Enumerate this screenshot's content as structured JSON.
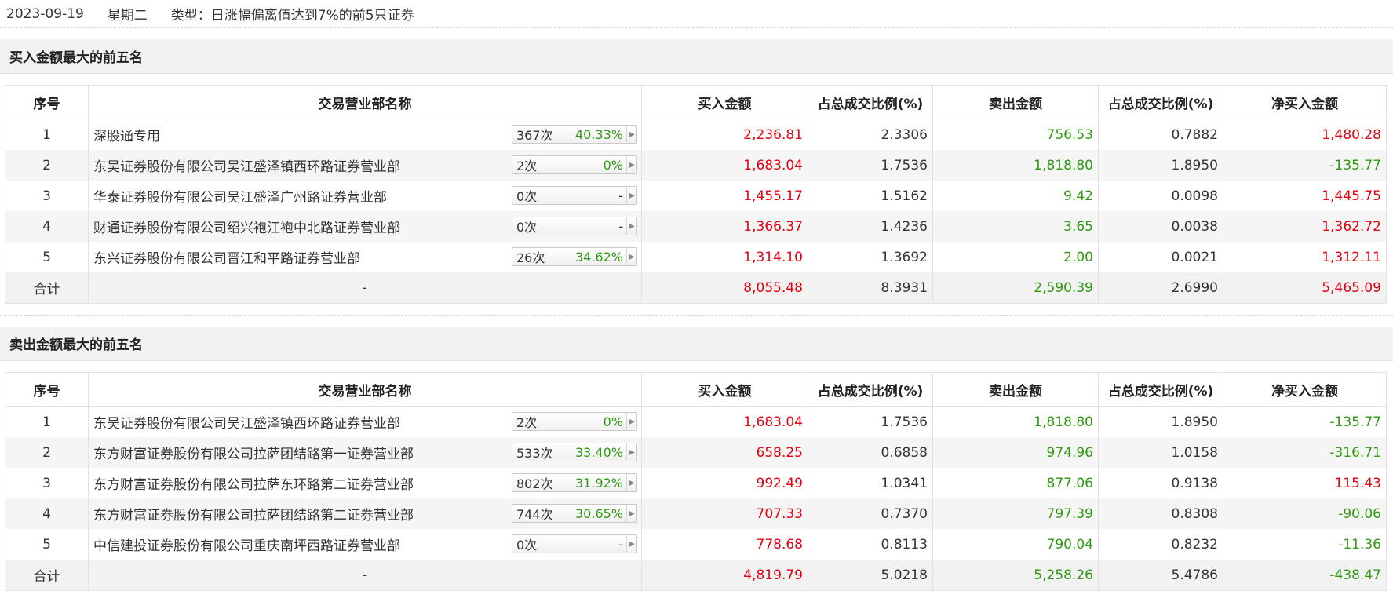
{
  "header": {
    "date": "2023-09-19",
    "weekday": "星期二",
    "type_label": "类型：日涨幅偏离值达到7%的前5只证券"
  },
  "columns": [
    "序号",
    "交易营业部名称",
    "买入金额",
    "占总成交比例(%)",
    "卖出金额",
    "占总成交比例(%)",
    "净买入金额"
  ],
  "colors": {
    "positive": "#e4000f",
    "negative": "#2f9a10"
  },
  "buy_section": {
    "title": "买入金额最大的前五名",
    "rows": [
      {
        "idx": "1",
        "name": "深股通专用",
        "count": "367次",
        "pct": "40.33%",
        "buy": "2,236.81",
        "buy_ratio": "2.3306",
        "sell": "756.53",
        "sell_ratio": "0.7882",
        "net": "1,480.28",
        "net_sign": "pos"
      },
      {
        "idx": "2",
        "name": "东吴证券股份有限公司吴江盛泽镇西环路证券营业部",
        "count": "2次",
        "pct": "0%",
        "buy": "1,683.04",
        "buy_ratio": "1.7536",
        "sell": "1,818.80",
        "sell_ratio": "1.8950",
        "net": "-135.77",
        "net_sign": "neg"
      },
      {
        "idx": "3",
        "name": "华泰证券股份有限公司吴江盛泽广州路证券营业部",
        "count": "0次",
        "pct": "-",
        "buy": "1,455.17",
        "buy_ratio": "1.5162",
        "sell": "9.42",
        "sell_ratio": "0.0098",
        "net": "1,445.75",
        "net_sign": "pos"
      },
      {
        "idx": "4",
        "name": "财通证券股份有限公司绍兴袍江袍中北路证券营业部",
        "count": "0次",
        "pct": "-",
        "buy": "1,366.37",
        "buy_ratio": "1.4236",
        "sell": "3.65",
        "sell_ratio": "0.0038",
        "net": "1,362.72",
        "net_sign": "pos"
      },
      {
        "idx": "5",
        "name": "东兴证券股份有限公司晋江和平路证券营业部",
        "count": "26次",
        "pct": "34.62%",
        "buy": "1,314.10",
        "buy_ratio": "1.3692",
        "sell": "2.00",
        "sell_ratio": "0.0021",
        "net": "1,312.11",
        "net_sign": "pos"
      }
    ],
    "total": {
      "label": "合计",
      "name": "-",
      "buy": "8,055.48",
      "buy_ratio": "8.3931",
      "sell": "2,590.39",
      "sell_ratio": "2.6990",
      "net": "5,465.09",
      "net_sign": "pos"
    }
  },
  "sell_section": {
    "title": "卖出金额最大的前五名",
    "rows": [
      {
        "idx": "1",
        "name": "东吴证券股份有限公司吴江盛泽镇西环路证券营业部",
        "count": "2次",
        "pct": "0%",
        "buy": "1,683.04",
        "buy_ratio": "1.7536",
        "sell": "1,818.80",
        "sell_ratio": "1.8950",
        "net": "-135.77",
        "net_sign": "neg"
      },
      {
        "idx": "2",
        "name": "东方财富证券股份有限公司拉萨团结路第一证券营业部",
        "count": "533次",
        "pct": "33.40%",
        "buy": "658.25",
        "buy_ratio": "0.6858",
        "sell": "974.96",
        "sell_ratio": "1.0158",
        "net": "-316.71",
        "net_sign": "neg"
      },
      {
        "idx": "3",
        "name": "东方财富证券股份有限公司拉萨东环路第二证券营业部",
        "count": "802次",
        "pct": "31.92%",
        "buy": "992.49",
        "buy_ratio": "1.0341",
        "sell": "877.06",
        "sell_ratio": "0.9138",
        "net": "115.43",
        "net_sign": "pos"
      },
      {
        "idx": "4",
        "name": "东方财富证券股份有限公司拉萨团结路第二证券营业部",
        "count": "744次",
        "pct": "30.65%",
        "buy": "707.33",
        "buy_ratio": "0.7370",
        "sell": "797.39",
        "sell_ratio": "0.8308",
        "net": "-90.06",
        "net_sign": "neg"
      },
      {
        "idx": "5",
        "name": "中信建投证券股份有限公司重庆南坪西路证券营业部",
        "count": "0次",
        "pct": "-",
        "buy": "778.68",
        "buy_ratio": "0.8113",
        "sell": "790.04",
        "sell_ratio": "0.8232",
        "net": "-11.36",
        "net_sign": "neg"
      }
    ],
    "total": {
      "label": "合计",
      "name": "-",
      "buy": "4,819.79",
      "buy_ratio": "5.0218",
      "sell": "5,258.26",
      "sell_ratio": "5.4786",
      "net": "-438.47",
      "net_sign": "neg"
    }
  }
}
